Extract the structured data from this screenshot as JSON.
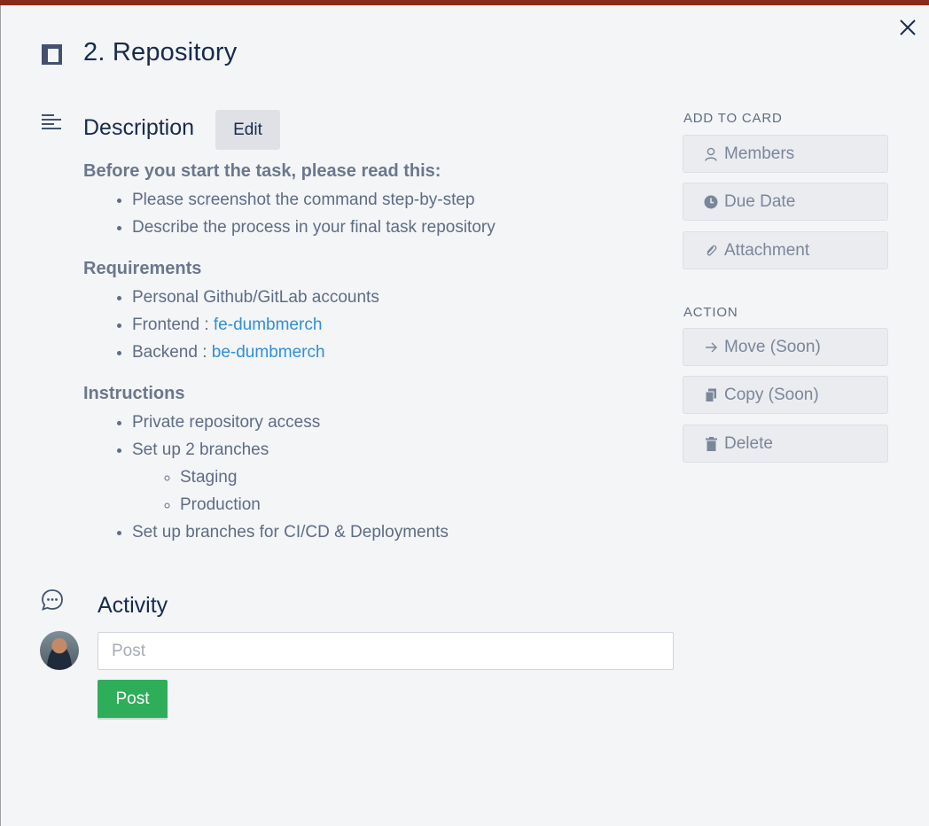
{
  "card": {
    "title": "2. Repository"
  },
  "description": {
    "heading": "Description",
    "edit_label": "Edit",
    "intro": {
      "heading": "Before you start the task, please read this:",
      "items": [
        "Please screenshot the command step-by-step",
        "Describe the process in your final task repository"
      ]
    },
    "requirements": {
      "heading": "Requirements",
      "item1": "Personal Github/GitLab accounts",
      "frontend_label": "Frontend : ",
      "frontend_link": "fe-dumbmerch",
      "backend_label": "Backend : ",
      "backend_link": "be-dumbmerch"
    },
    "instructions": {
      "heading": "Instructions",
      "item1": "Private repository access",
      "item2": "Set up 2 branches",
      "sub_items": [
        "Staging",
        "Production"
      ],
      "item3": "Set up branches for CI/CD & Deployments"
    }
  },
  "sidebar": {
    "add_to_card": {
      "heading": "ADD TO CARD",
      "buttons": [
        {
          "label": "Members",
          "icon": "person-icon"
        },
        {
          "label": "Due Date",
          "icon": "clock-icon"
        },
        {
          "label": "Attachment",
          "icon": "paperclip-icon"
        }
      ]
    },
    "action": {
      "heading": "ACTION",
      "buttons": [
        {
          "label": "Move (Soon)",
          "icon": "arrow-right-icon"
        },
        {
          "label": "Copy (Soon)",
          "icon": "copy-icon"
        },
        {
          "label": "Delete",
          "icon": "trash-icon"
        }
      ]
    }
  },
  "activity": {
    "heading": "Activity",
    "input_placeholder": "Post",
    "post_label": "Post"
  },
  "colors": {
    "topbar": "#8a2a1a",
    "post_button": "#2fae5a",
    "link": "#2f8fd8"
  }
}
